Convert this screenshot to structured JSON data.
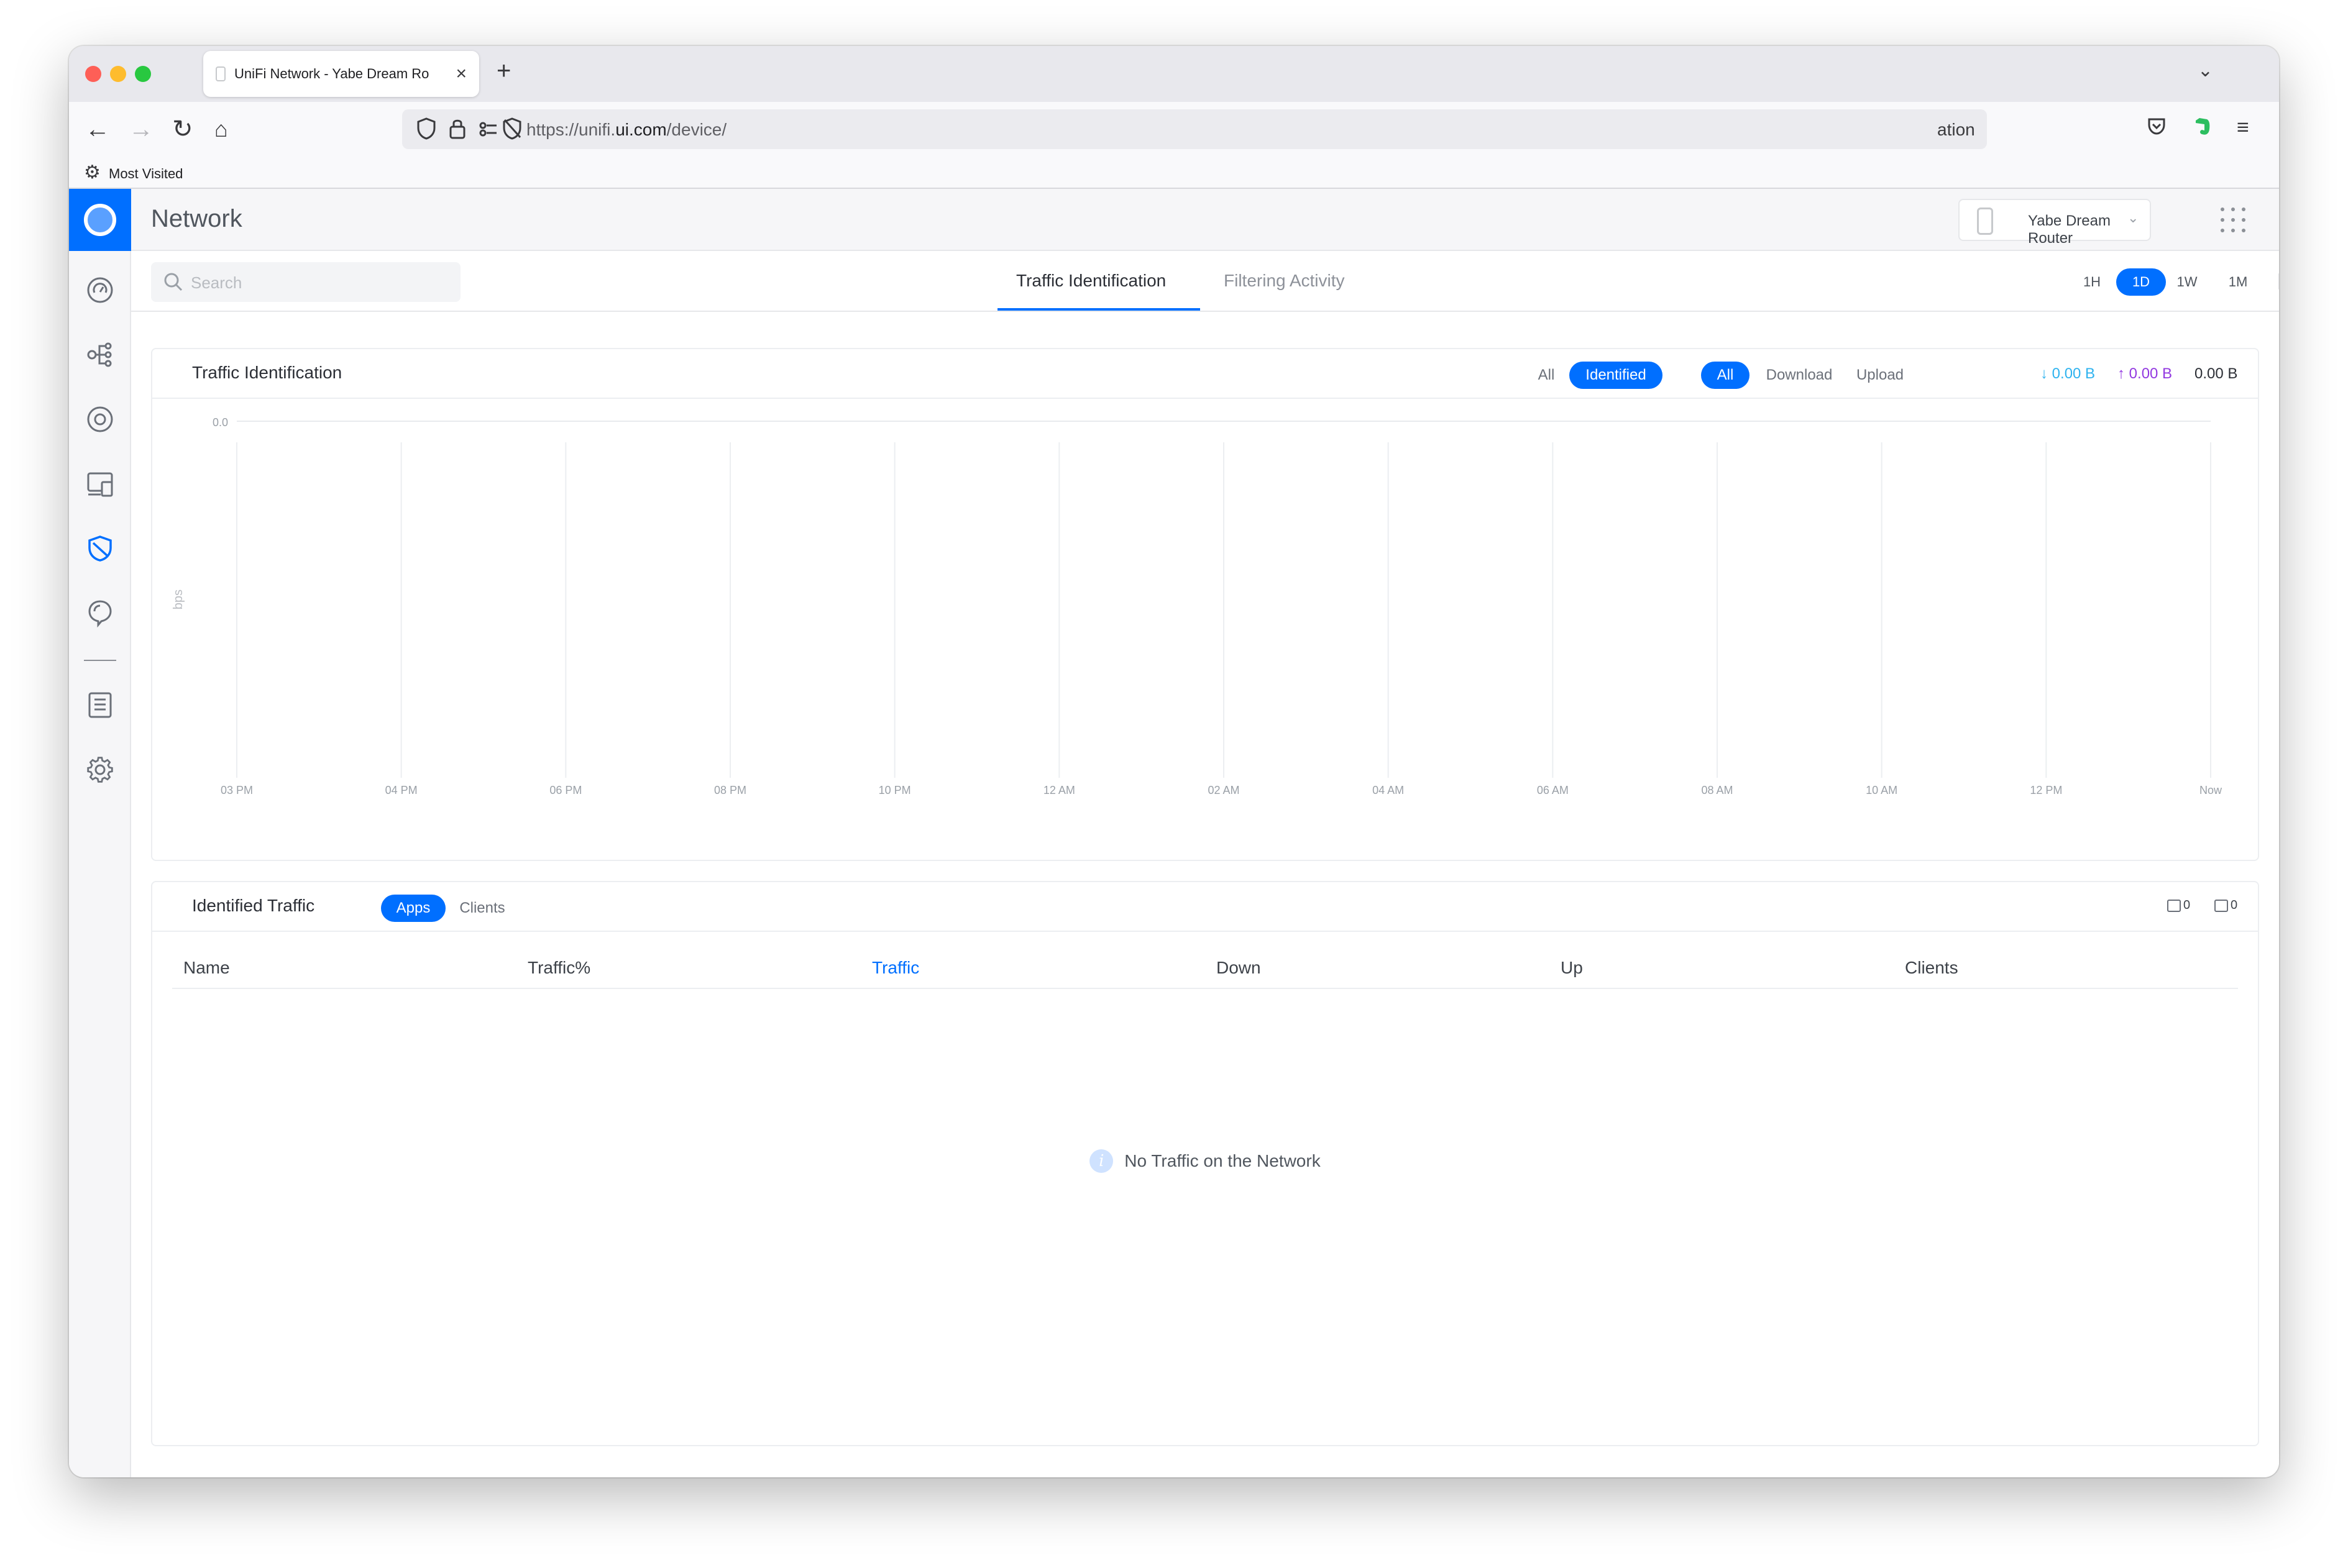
{
  "browser": {
    "tab_title": "UniFi Network - Yabe Dream Ro",
    "url_prefix": "https://unifi.",
    "url_host": "ui.com",
    "url_path": "/device/",
    "url_tail": "ation",
    "bookmark_label": "Most Visited"
  },
  "app": {
    "title": "Network",
    "device_name": "Yabe Dream Router",
    "accent_color": "#006fff"
  },
  "sidebar": {
    "items": [
      {
        "name": "dashboard-icon"
      },
      {
        "name": "topology-icon"
      },
      {
        "name": "devices-icon"
      },
      {
        "name": "clients-icon"
      },
      {
        "name": "traffic-shield-icon"
      },
      {
        "name": "insights-icon"
      },
      {
        "name": "logs-icon"
      },
      {
        "name": "settings-icon"
      }
    ]
  },
  "subheader": {
    "search_placeholder": "Search",
    "tabs": [
      {
        "label": "Traffic Identification",
        "active": true
      },
      {
        "label": "Filtering Activity",
        "active": false
      }
    ],
    "ranges": [
      {
        "label": "1H",
        "active": false
      },
      {
        "label": "1D",
        "active": true
      },
      {
        "label": "1W",
        "active": false
      },
      {
        "label": "1M",
        "active": false
      }
    ]
  },
  "traffic_card": {
    "title": "Traffic Identification",
    "filter_all": "All",
    "filter_identified": "Identified",
    "dir_all": "All",
    "dir_download": "Download",
    "dir_upload": "Upload",
    "download_total": "0.00 B",
    "upload_total": "0.00 B",
    "total": "0.00 B",
    "colors": {
      "download": "#2fb3ef",
      "upload": "#9239e0"
    }
  },
  "chart_data": {
    "type": "area",
    "title": "Traffic Identification",
    "ylabel": "bps",
    "y_ticks": [
      "0.0"
    ],
    "ylim": [
      0,
      0
    ],
    "x": [
      "03 PM",
      "04 PM",
      "06 PM",
      "08 PM",
      "10 PM",
      "12 AM",
      "02 AM",
      "04 AM",
      "06 AM",
      "08 AM",
      "10 AM",
      "12 PM",
      "Now"
    ],
    "series": [],
    "grid": true
  },
  "identified_card": {
    "title": "Identified Traffic",
    "toggle_apps": "Apps",
    "toggle_clients": "Clients",
    "apps_count": "0",
    "clients_count": "0",
    "columns": [
      "Name",
      "Traffic%",
      "Traffic",
      "Down",
      "Up",
      "Clients"
    ],
    "sorted_column": "Traffic",
    "rows": [],
    "empty_message": "No Traffic on the Network"
  }
}
